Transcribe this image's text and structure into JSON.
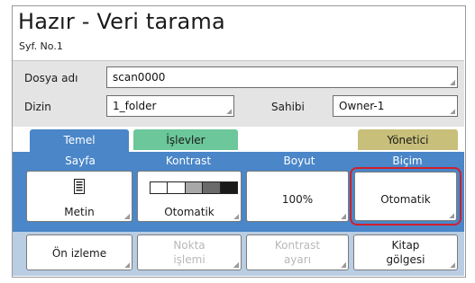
{
  "header": {
    "title": "Hazır - Veri tarama",
    "subtitle": "Syf. No.1"
  },
  "fields": {
    "file_name": {
      "label": "Dosya adı",
      "value": "scan0000"
    },
    "directory": {
      "label": "Dizin",
      "value": "1_folder"
    },
    "owner": {
      "label": "Sahibi",
      "value": "Owner-1"
    }
  },
  "tabs": [
    {
      "label": "Temel",
      "color": "#4a86c8",
      "active": true
    },
    {
      "label": "İşlevler",
      "color": "#6cc79a",
      "active": false
    },
    {
      "label": "Yönetici",
      "color": "#c8bf7a",
      "active": false
    }
  ],
  "columns": {
    "page": "Sayfa",
    "contrast": "Kontrast",
    "size": "Boyut",
    "format": "Biçim"
  },
  "settings": {
    "page": {
      "value": "Metin",
      "icon": "document-text-icon"
    },
    "contrast": {
      "value": "Otomatik",
      "icon": "contrast-scale-icon"
    },
    "size": {
      "value": "100%"
    },
    "format": {
      "value": "Otomatik",
      "selected": true
    }
  },
  "actions": {
    "preview": {
      "label": "Ön izleme",
      "enabled": true
    },
    "dot_processing": {
      "line1": "Nokta",
      "line2": "işlemi",
      "enabled": false
    },
    "contrast_adjust": {
      "line1": "Kontrast",
      "line2": "ayarı",
      "enabled": false
    },
    "book_shadow": {
      "line1": "Kitap",
      "line2": "gölgesi",
      "enabled": true
    }
  },
  "colors": {
    "accent": "#4a86c8",
    "selection": "#d0202c"
  }
}
